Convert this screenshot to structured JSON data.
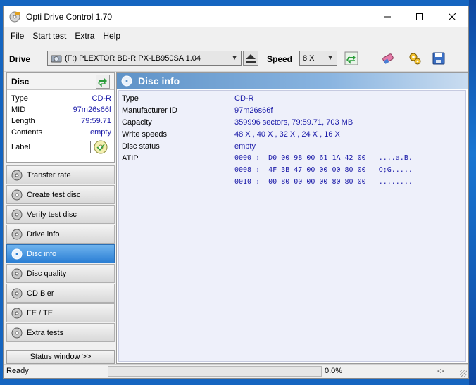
{
  "window": {
    "title": "Opti Drive Control 1.70"
  },
  "menu": [
    "File",
    "Start test",
    "Extra",
    "Help"
  ],
  "toolbar": {
    "drive_label": "Drive",
    "drive_value": "(F:)  PLEXTOR BD-R  PX-LB950SA 1.04",
    "speed_label": "Speed",
    "speed_value": "8 X"
  },
  "disc": {
    "header": "Disc",
    "props": [
      {
        "key": "Type",
        "value": "CD-R"
      },
      {
        "key": "MID",
        "value": "97m26s66f"
      },
      {
        "key": "Length",
        "value": "79:59.71"
      },
      {
        "key": "Contents",
        "value": "empty"
      }
    ],
    "label_caption": "Label"
  },
  "nav": [
    {
      "label": "Transfer rate",
      "active": false
    },
    {
      "label": "Create test disc",
      "active": false
    },
    {
      "label": "Verify test disc",
      "active": false
    },
    {
      "label": "Drive info",
      "active": false
    },
    {
      "label": "Disc info",
      "active": true
    },
    {
      "label": "Disc quality",
      "active": false
    },
    {
      "label": "CD Bler",
      "active": false
    },
    {
      "label": "FE / TE",
      "active": false
    },
    {
      "label": "Extra tests",
      "active": false
    }
  ],
  "status_window_btn": "Status window >>",
  "main": {
    "title": "Disc info",
    "rows": [
      {
        "key": "Type",
        "value": "CD-R"
      },
      {
        "key": "Manufacturer ID",
        "value": "97m26s66f"
      },
      {
        "key": "Capacity",
        "value": "359996 sectors, 79:59.71, 703 MB"
      },
      {
        "key": "Write speeds",
        "value": "48 X , 40 X , 32 X , 24 X , 16 X"
      },
      {
        "key": "Disc status",
        "value": "empty"
      },
      {
        "key": "ATIP",
        "value": ""
      }
    ],
    "atip": [
      "0000 :  D0 00 98 00 61 1A 42 00   ....a.B.",
      "0008 :  4F 3B 47 00 00 00 80 00   O;G.....",
      "0010 :  00 80 00 00 00 80 80 00   ........"
    ]
  },
  "statusbar": {
    "text": "Ready",
    "progress": 0.0,
    "percent": "0.0%",
    "time": "-:-"
  },
  "colors": {
    "accent": "#2b7fd4",
    "value_blue": "#1a1aa8"
  }
}
